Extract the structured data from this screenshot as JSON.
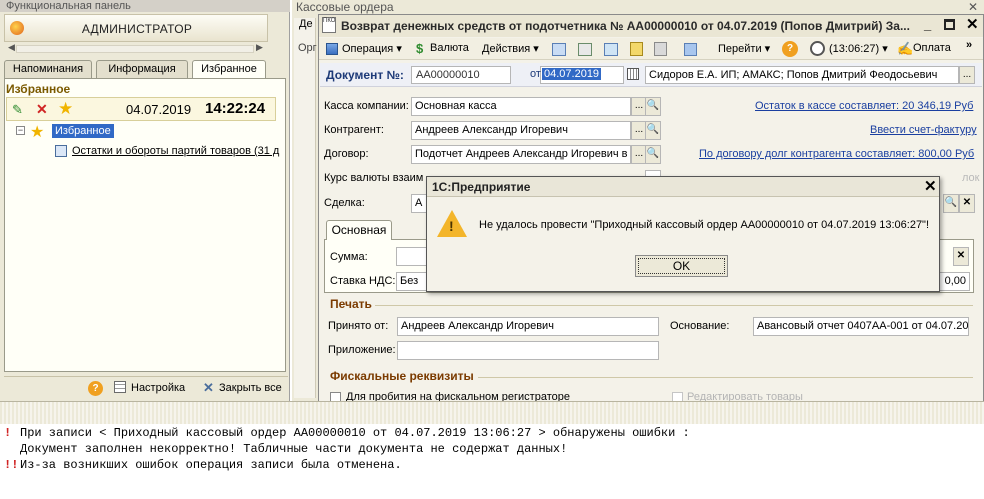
{
  "left_panel": {
    "title": "Функциональная панель",
    "close_glyph": "✕",
    "admin_label": "АДМИНИСТРАТОР",
    "tabs": [
      {
        "label": "Напоминания"
      },
      {
        "label": "Информация"
      },
      {
        "label": "Избранное"
      }
    ],
    "favorites_header": "Избранное",
    "date": "04.07.2019",
    "time": "14:22:24",
    "tree_root_label": "Избранное",
    "tree_item_label": "Остатки и обороты партий товаров (31 д",
    "bottom": {
      "help_glyph": "?",
      "settings_label": "Настройка",
      "close_all_label": "Закрыть все"
    }
  },
  "background_window": {
    "title": "Кассовые ордера",
    "col_label_1": "Де",
    "col_label_2": "Орг"
  },
  "document": {
    "title": "Возврат денежных средств от подотчетника № АА00000010 от 04.07.2019 (Попов Дмитрий) За...",
    "toolbar": {
      "operation": "Операция ▾",
      "currency": "Валюта",
      "actions": "Действия ▾",
      "goto": "Перейти ▾",
      "help_glyph": "?",
      "time": "(13:06:27) ▾",
      "payment": "Оплата",
      "more_glyph": "»"
    },
    "number_label": "Документ №:",
    "number_value": "АА00000010",
    "date_label": "от",
    "date_value": "04.07.2019",
    "organization": "Сидоров Е.А. ИП; АМАКС; Попов Дмитрий Феодосьевич",
    "fields": {
      "cash_label": "Касса компании:",
      "cash_value": "Основная касса",
      "contractor_label": "Контрагент:",
      "contractor_value": "Андреев Александр Игоревич",
      "contract_label": "Договор:",
      "contract_value": "Подотчет Андреев Александр Игоревич в ...",
      "rate_label": "Курс валюты взаим",
      "deal_label": "Сделка:",
      "deal_value": "А"
    },
    "links": {
      "balance": "Остаток в кассе составляет: 20 346,19 Руб",
      "invoice": "Ввести счет-фактуру",
      "debt": "По договору долг контрагента составляет: 800,00 Руб"
    },
    "checkbox_tail": "лок",
    "tab_main": "Основная",
    "sum_label": "Сумма:",
    "vat_label": "Ставка НДС:",
    "vat_value": "Без",
    "vat_amount": "0,00",
    "print_section": "Печать",
    "accepted_label": "Принято от:",
    "accepted_value": "Андреев Александр Игоревич",
    "basis_label": "Основание:",
    "basis_value": "Авансовый отчет 0407АА-001 от 04.07.20",
    "attachment_label": "Приложение:",
    "fiscal_section": "Фискальные реквизиты",
    "fiscal_checkbox_label": "Для пробития на фискальном регистраторе",
    "edit_goods_label": "Редактировать товары",
    "dots_glyph": "...",
    "search_glyph": "🔍",
    "clear_glyph": "✕"
  },
  "dialog": {
    "title": "1С:Предприятие",
    "close_glyph": "✕",
    "warn_glyph": "!",
    "message": "Не удалось провести \"Приходный кассовый ордер АА00000010 от 04.07.2019 13:06:27\"!",
    "ok_label": "OK"
  },
  "log": {
    "mark_1": "!",
    "line_1": "При записи < Приходный кассовый ордер АА00000010 от 04.07.2019 13:06:27 > обнаружены ошибки :",
    "line_2": "Документ заполнен некорректно! Табличные части документа не содержат данных!",
    "mark_3": "!!",
    "line_3": "Из-за возникших ошибок операция записи была отменена."
  }
}
